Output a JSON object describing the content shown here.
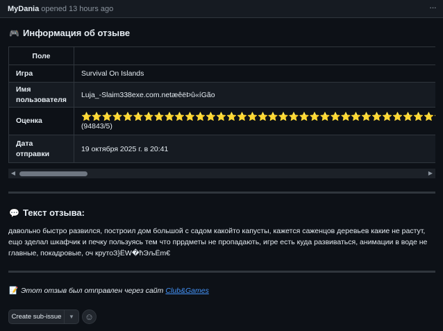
{
  "header": {
    "author": "MyDania",
    "opened_text": "opened 13 hours ago",
    "menu_icon": "kebab-horizontal-icon"
  },
  "info_section": {
    "icon": "gamepad-icon",
    "title": "Информация об отзыве",
    "table": {
      "header_cell": "Поле",
      "rows": [
        {
          "label": "Игра",
          "value": "Survival On Islands"
        },
        {
          "label": "Имя пользователя",
          "value": "Luja_-Slaim338exe.com.netæêëÞû«íGão"
        },
        {
          "label": "Оценка",
          "stars": "⭐⭐⭐⭐⭐⭐⭐⭐⭐⭐⭐⭐⭐⭐⭐⭐⭐⭐⭐⭐⭐⭐⭐⭐⭐⭐⭐⭐⭐⭐⭐⭐⭐⭐⭐⭐⭐⭐⭐⭐⭐",
          "value": "(94843/5)"
        },
        {
          "label": "Дата отправки",
          "value": "19 октября 2025 г. в 20:41"
        }
      ]
    }
  },
  "review_section": {
    "icon": "speech-bubble-icon",
    "title": "Текст отзыва:",
    "text": "давольно быстро развился, построил дом большой с садом какойто капусты, кажется саженцов деревьев какие не растут, ещо зделал шкафчик и печку пользуясь тем что пррдметы не пропадають, игре есть куда развиваться, анимации в воде не главные, покадровые, оч крутоЗ}ЁW�ћЭљЁm€"
  },
  "footer": {
    "icon": "memo-icon",
    "note": "Этот отзыв был отправлен через сайт",
    "link": "Club&Games"
  },
  "actions": {
    "create_sub_issue": "Create sub-issue",
    "caret_icon": "triangle-down-icon",
    "emoji_icon": "smiley-icon"
  }
}
